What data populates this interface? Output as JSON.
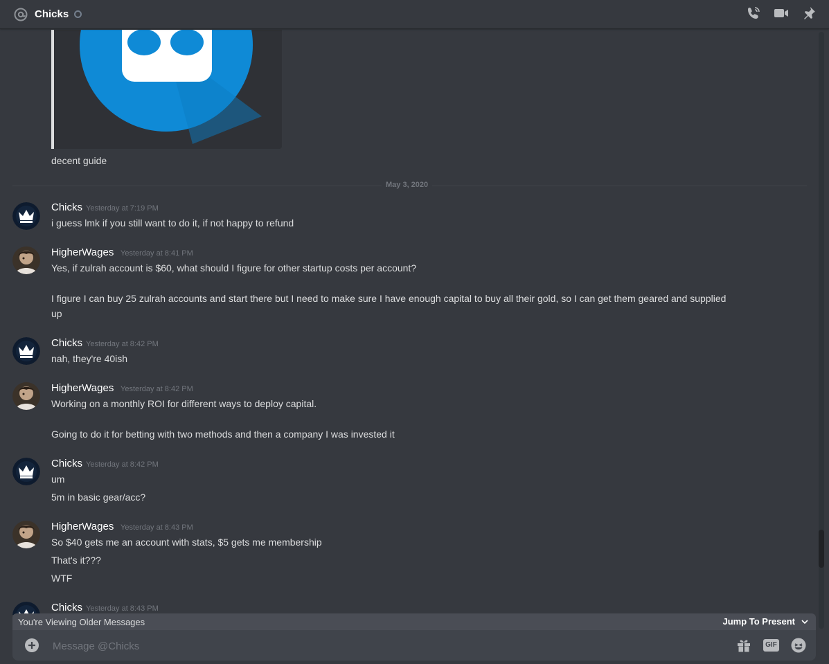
{
  "header": {
    "channel_name": "Chicks",
    "icons": [
      "at-icon",
      "status-dot",
      "call-icon",
      "video-icon",
      "pin-icon"
    ]
  },
  "previous": {
    "embed_icon": "bot-logo-icon",
    "text": "decent guide"
  },
  "divider": {
    "date": "May 3, 2020"
  },
  "messages": [
    {
      "author": "Chicks",
      "avatar": "crown-avatar",
      "timestamp": "Yesterday at 7:19 PM",
      "lines": [
        "i guess lmk if you still want to do it, if not happy to refund"
      ]
    },
    {
      "author": "HigherWages",
      "avatar": "photo-avatar",
      "timestamp": "Yesterday at 8:41 PM",
      "lines": [
        "Yes, if zulrah account is $60, what should I figure for other startup costs per account?",
        "I figure I can buy 25 zulrah accounts and start there but I need to make sure I have enough capital to buy all their gold, so I can get them geared and supplied",
        "up"
      ]
    },
    {
      "author": "Chicks",
      "avatar": "crown-avatar",
      "timestamp": "Yesterday at 8:42 PM",
      "lines": [
        "nah, they're 40ish"
      ]
    },
    {
      "author": "HigherWages",
      "avatar": "photo-avatar",
      "timestamp": "Yesterday at 8:42 PM",
      "lines": [
        "Working on a monthly ROI for different ways to deploy capital.",
        "Going to do it for betting with two methods and then a company I was invested it"
      ]
    },
    {
      "author": "Chicks",
      "avatar": "crown-avatar",
      "timestamp": "Yesterday at 8:42 PM",
      "lines": [
        "um",
        "5m in basic gear/acc?"
      ]
    },
    {
      "author": "HigherWages",
      "avatar": "photo-avatar",
      "timestamp": "Yesterday at 8:43 PM",
      "lines": [
        "So $40 gets me an account with stats, $5 gets me membership",
        "That's it???",
        "WTF"
      ]
    },
    {
      "author": "Chicks",
      "avatar": "crown-avatar",
      "timestamp": "Yesterday at 8:43 PM",
      "lines": []
    }
  ],
  "older_bar": {
    "text": "You're Viewing Older Messages",
    "jump_label": "Jump To Present"
  },
  "composer": {
    "placeholder": "Message @Chicks",
    "gif_label": "GIF",
    "icons": [
      "add-icon",
      "gift-icon",
      "emoji-icon"
    ]
  }
}
